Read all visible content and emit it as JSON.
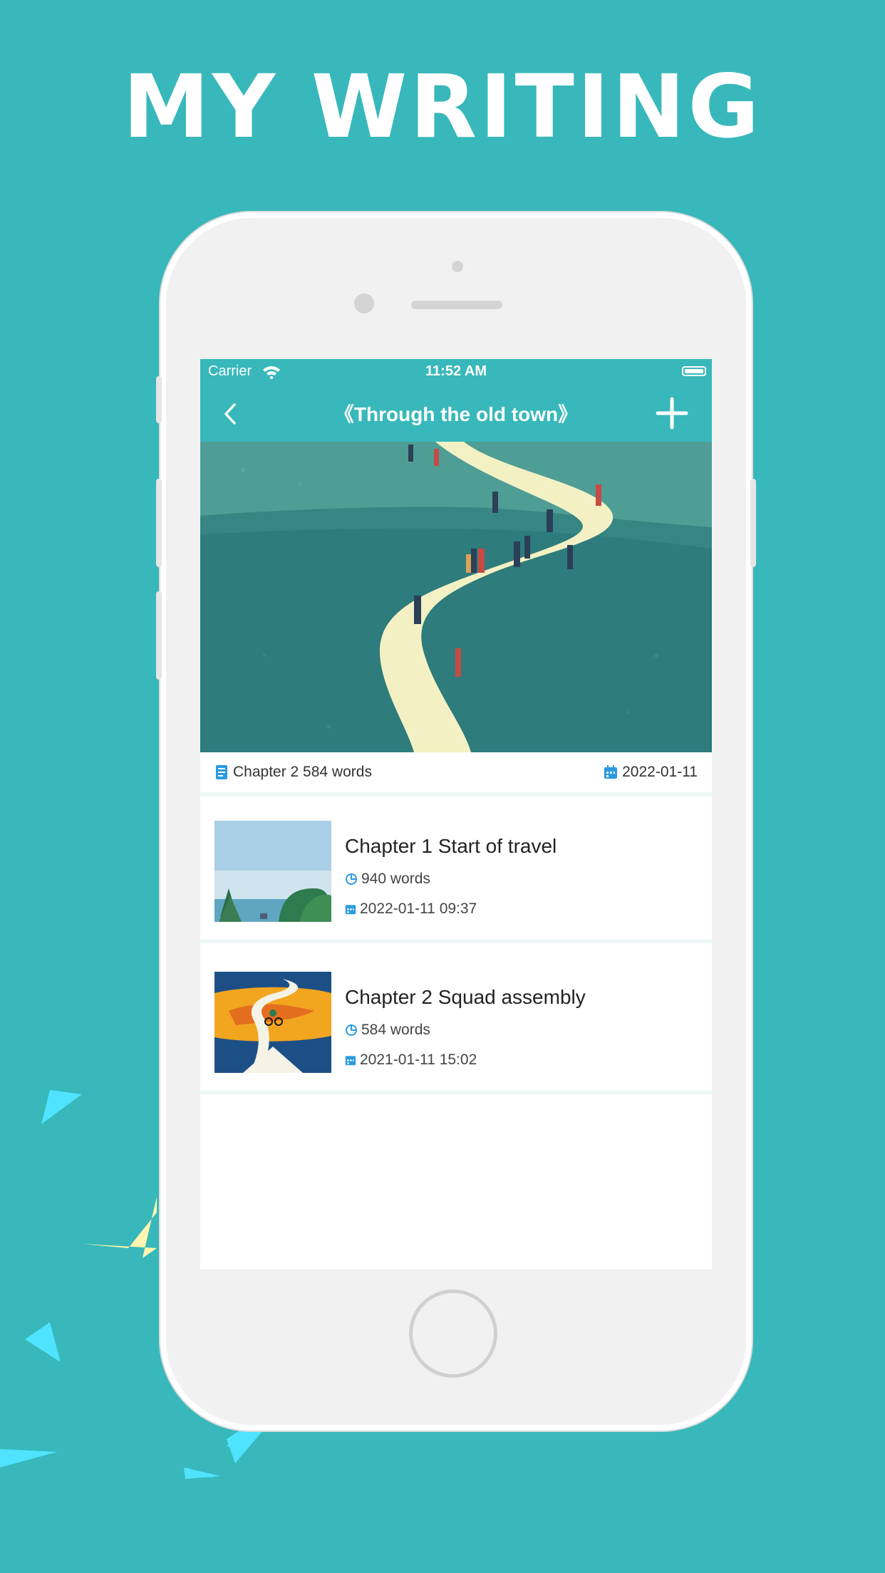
{
  "headline": "MY WRITING",
  "status_bar": {
    "carrier": "Carrier",
    "time": "11:52 AM"
  },
  "nav": {
    "title": "《Through the old town》"
  },
  "book_info": {
    "chapter_words": "Chapter 2 584 words",
    "date": "2022-01-11"
  },
  "chapters": [
    {
      "title": "Chapter 1 Start of travel",
      "words": "940 words",
      "datetime": "2022-01-11 09:37"
    },
    {
      "title": "Chapter 2 Squad assembly",
      "words": "584 words",
      "datetime": "2021-01-11 15:02"
    }
  ],
  "colors": {
    "background": "#38b8ba",
    "accent": "#38b8ba",
    "icon_blue": "#2a9be0"
  }
}
